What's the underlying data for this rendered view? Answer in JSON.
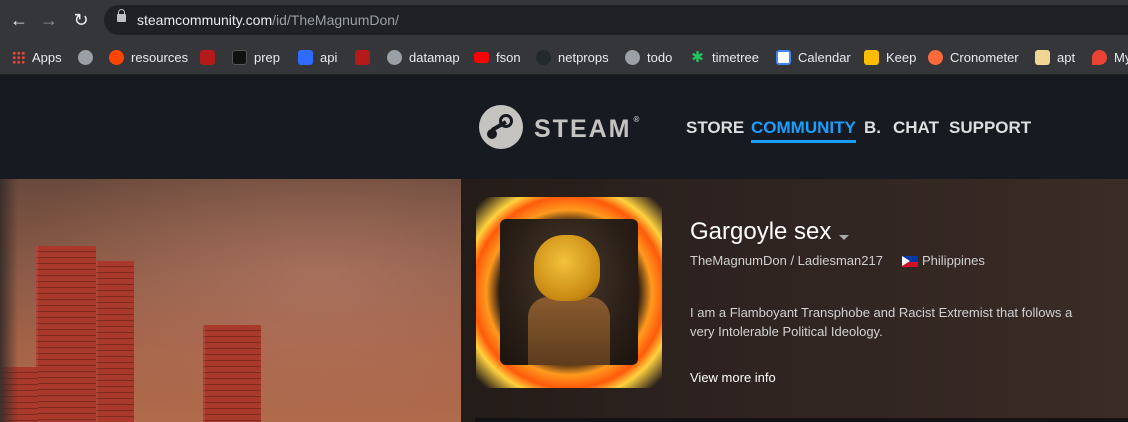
{
  "browser": {
    "url_host": "steamcommunity.com",
    "url_path": "/id/TheMagnumDon/"
  },
  "bookmarks": [
    {
      "label": "Apps",
      "icon": "apps-grid-icon",
      "color": "#ea4335"
    },
    {
      "label": "",
      "icon": "globe-icon",
      "color": "#9aa0a6"
    },
    {
      "label": "resources",
      "icon": "reddit-icon",
      "color": "#ff4500"
    },
    {
      "label": "",
      "icon": "bookmark-red-icon",
      "color": "#b31b1b"
    },
    {
      "label": "prep",
      "icon": "prep-icon",
      "color": "#111111"
    },
    {
      "label": "api",
      "icon": "api-icon",
      "color": "#2f6bff"
    },
    {
      "label": "",
      "icon": "bookmark-red-icon",
      "color": "#b31b1b"
    },
    {
      "label": "datamap",
      "icon": "globe-icon",
      "color": "#9aa0a6"
    },
    {
      "label": "fson",
      "icon": "youtube-icon",
      "color": "#ff0000"
    },
    {
      "label": "netprops",
      "icon": "github-icon",
      "color": "#24292e"
    },
    {
      "label": "todo",
      "icon": "globe-icon",
      "color": "#9aa0a6"
    },
    {
      "label": "timetree",
      "icon": "timetree-icon",
      "color": "#22c55e"
    },
    {
      "label": "Calendar",
      "icon": "calendar-icon",
      "color": "#4285f4"
    },
    {
      "label": "Keep",
      "icon": "keep-icon",
      "color": "#fbbc04"
    },
    {
      "label": "Cronometer",
      "icon": "cronometer-icon",
      "color": "#ff6a3d"
    },
    {
      "label": "apt",
      "icon": "folder-icon",
      "color": "#f1d592"
    },
    {
      "label": "My",
      "icon": "maps-icon",
      "color": "#ea4335"
    }
  ],
  "steam": {
    "logo_text": "STEAM",
    "logo_reg": "®",
    "nav": [
      "STORE",
      "COMMUNITY",
      "B.",
      "CHAT",
      "SUPPORT"
    ],
    "active_nav": "COMMUNITY",
    "accent_color": "#1a9fff"
  },
  "profile": {
    "name": "Gargoyle sex",
    "aliases": "TheMagnumDon / Ladiesman217",
    "country": "Philippines",
    "summary": "I am a Flamboyant Transphobe and Racist Extremist that follows a very Intolerable Political Ideology.",
    "view_more": "View more info"
  }
}
